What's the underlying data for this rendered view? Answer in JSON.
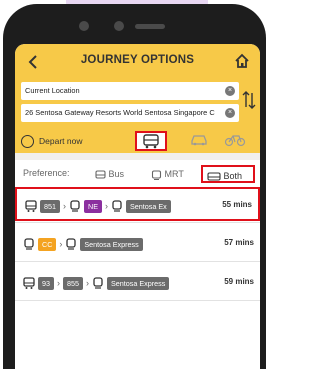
{
  "header": {
    "title": "JOURNEY OPTIONS"
  },
  "search": {
    "from_value": "Current Location",
    "to_value": "26 Sentosa Gateway Resorts World Sentosa Singapore C"
  },
  "depart": {
    "label": "Depart now"
  },
  "preference": {
    "label": "Preference:",
    "options": [
      {
        "label": "Bus"
      },
      {
        "label": "MRT"
      },
      {
        "label": "Both"
      }
    ]
  },
  "routes": [
    {
      "legs": [
        "851",
        "NE",
        "Sentosa Ex"
      ],
      "duration": "55 mins"
    },
    {
      "legs": [
        "CC",
        "Sentosa Express"
      ],
      "duration": "57 mins"
    },
    {
      "legs": [
        "93",
        "855",
        "Sentosa Express"
      ],
      "duration": "59 mins"
    }
  ],
  "colors": {
    "accent": "#f7c948",
    "highlight": "#e0101a",
    "ne_line": "#8b2f9f",
    "cc_line": "#f4a321"
  }
}
